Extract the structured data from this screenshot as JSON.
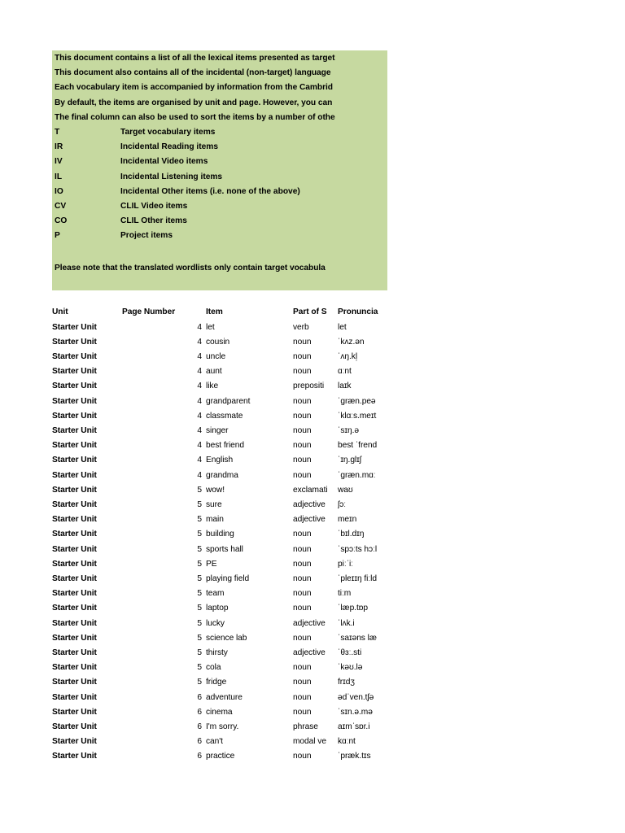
{
  "document": {
    "background_color": "#ffffff",
    "panel_color": "#c6d9a0",
    "text_color": "#000000"
  },
  "intro": {
    "lines": [
      "This document contains a list of all the lexical items presented as target",
      "This document also contains all of the incidental (non-target) language",
      "Each vocabulary item is accompanied by information from the Cambrid",
      "By default, the items are organised by unit and page. However, you can",
      "The final column can also be used to sort the items by a number of othe"
    ],
    "legend": [
      {
        "code": "T",
        "description": "Target vocabulary items"
      },
      {
        "code": "IR",
        "description": "Incidental Reading items"
      },
      {
        "code": "IV",
        "description": "Incidental Video items"
      },
      {
        "code": "IL",
        "description": "Incidental Listening items"
      },
      {
        "code": "IO",
        "description": "Incidental Other items (i.e. none of the above)"
      },
      {
        "code": "CV",
        "description": "CLIL Video items"
      },
      {
        "code": "CO",
        "description": "CLIL Other items"
      },
      {
        "code": "P",
        "description": "Project items"
      }
    ],
    "note": "Please note that the translated wordlists only contain target vocabula"
  },
  "table": {
    "headers": {
      "unit": "Unit",
      "page": "Page Number",
      "item": "Item",
      "pos": "Part of S",
      "pron": "Pronuncia"
    },
    "rows": [
      {
        "unit": "Starter Unit",
        "page": "4",
        "item": "let",
        "pos": "verb",
        "pron": "let"
      },
      {
        "unit": "Starter Unit",
        "page": "4",
        "item": "cousin",
        "pos": "noun",
        "pron": "ˈkʌz.ən"
      },
      {
        "unit": "Starter Unit",
        "page": "4",
        "item": "uncle",
        "pos": "noun",
        "pron": "ˈʌŋ.kl̩"
      },
      {
        "unit": "Starter Unit",
        "page": "4",
        "item": "aunt",
        "pos": "noun",
        "pron": "ɑːnt"
      },
      {
        "unit": "Starter Unit",
        "page": "4",
        "item": "like",
        "pos": "prepositi",
        "pron": "laɪk"
      },
      {
        "unit": "Starter Unit",
        "page": "4",
        "item": "grandparent",
        "pos": "noun",
        "pron": "ˈɡræn.peə"
      },
      {
        "unit": "Starter Unit",
        "page": "4",
        "item": "classmate",
        "pos": "noun",
        "pron": "ˈklɑːs.meɪt"
      },
      {
        "unit": "Starter Unit",
        "page": "4",
        "item": "singer",
        "pos": "noun",
        "pron": "ˈsɪŋ.ə"
      },
      {
        "unit": "Starter Unit",
        "page": "4",
        "item": "best friend",
        "pos": "noun",
        "pron": "best ˈfrend"
      },
      {
        "unit": "Starter Unit",
        "page": "4",
        "item": "English",
        "pos": "noun",
        "pron": "ˈɪŋ.ɡlɪʃ"
      },
      {
        "unit": "Starter Unit",
        "page": "4",
        "item": "grandma",
        "pos": "noun",
        "pron": "ˈɡræn.mɑː"
      },
      {
        "unit": "Starter Unit",
        "page": "5",
        "item": "wow!",
        "pos": "exclamati",
        "pron": "waʊ"
      },
      {
        "unit": "Starter Unit",
        "page": "5",
        "item": "sure",
        "pos": "adjective",
        "pron": "ʃɔː"
      },
      {
        "unit": "Starter Unit",
        "page": "5",
        "item": "main",
        "pos": "adjective",
        "pron": "meɪn"
      },
      {
        "unit": "Starter Unit",
        "page": "5",
        "item": "building",
        "pos": "noun",
        "pron": "ˈbɪl.dɪŋ"
      },
      {
        "unit": "Starter Unit",
        "page": "5",
        "item": "sports hall",
        "pos": "noun",
        "pron": "ˈspɔːts hɔːl"
      },
      {
        "unit": "Starter Unit",
        "page": "5",
        "item": "PE",
        "pos": "noun",
        "pron": "piːˈiː"
      },
      {
        "unit": "Starter Unit",
        "page": "5",
        "item": "playing field",
        "pos": "noun",
        "pron": "ˈpleɪɪŋ fiːld"
      },
      {
        "unit": "Starter Unit",
        "page": "5",
        "item": "team",
        "pos": "noun",
        "pron": "tiːm"
      },
      {
        "unit": "Starter Unit",
        "page": "5",
        "item": "laptop",
        "pos": "noun",
        "pron": "ˈlæp.tɒp"
      },
      {
        "unit": "Starter Unit",
        "page": "5",
        "item": "lucky",
        "pos": "adjective",
        "pron": "ˈlʌk.i"
      },
      {
        "unit": "Starter Unit",
        "page": "5",
        "item": "science lab",
        "pos": "noun",
        "pron": "ˈsaɪəns læ"
      },
      {
        "unit": "Starter Unit",
        "page": "5",
        "item": "thirsty",
        "pos": "adjective",
        "pron": "ˈθɜː.sti"
      },
      {
        "unit": "Starter Unit",
        "page": "5",
        "item": "cola",
        "pos": "noun",
        "pron": "ˈkəʊ.lə"
      },
      {
        "unit": "Starter Unit",
        "page": "5",
        "item": "fridge",
        "pos": "noun",
        "pron": "frɪdʒ"
      },
      {
        "unit": "Starter Unit",
        "page": "6",
        "item": "adventure",
        "pos": "noun",
        "pron": "ədˈven.tʃə"
      },
      {
        "unit": "Starter Unit",
        "page": "6",
        "item": "cinema",
        "pos": "noun",
        "pron": "ˈsɪn.ə.mə"
      },
      {
        "unit": "Starter Unit",
        "page": "6",
        "item": "I'm sorry.",
        "pos": "phrase",
        "pron": "aɪmˈsɒr.i"
      },
      {
        "unit": "Starter Unit",
        "page": "6",
        "item": "can't",
        "pos": "modal ve",
        "pron": "kɑːnt"
      },
      {
        "unit": "Starter Unit",
        "page": "6",
        "item": "practice",
        "pos": "noun",
        "pron": "ˈpræk.tɪs"
      }
    ]
  }
}
